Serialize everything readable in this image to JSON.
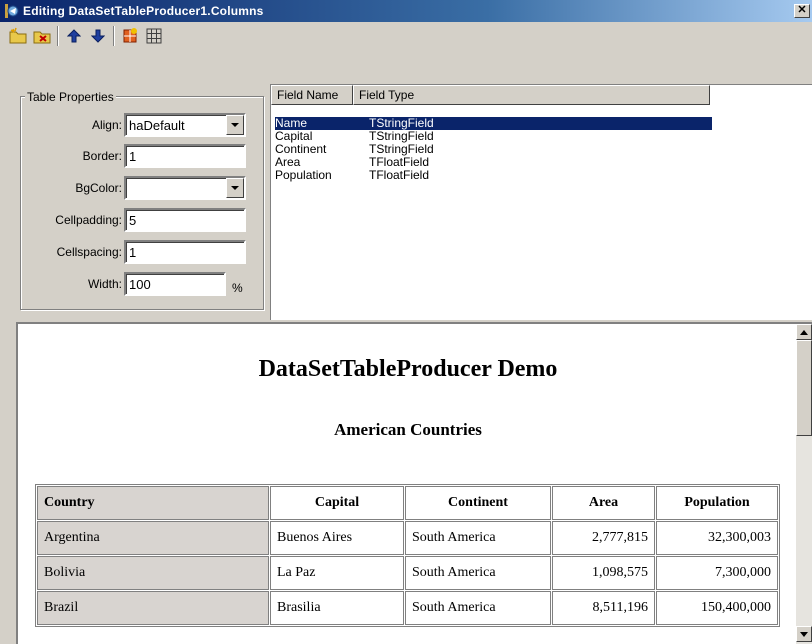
{
  "window": {
    "title": "Editing DataSetTableProducer1.Columns",
    "close_label": "✕"
  },
  "toolbar": {
    "buttons": [
      {
        "icon": "add-all-fields-icon"
      },
      {
        "icon": "delete-field-icon"
      },
      {
        "icon": "move-up-icon"
      },
      {
        "icon": "move-down-icon"
      },
      {
        "icon": "restore-defaults-icon"
      },
      {
        "icon": "grid-icon"
      }
    ]
  },
  "table_properties": {
    "caption": "Table Properties",
    "align_label": "Align:",
    "align_value": "haDefault",
    "border_label": "Border:",
    "border_value": "1",
    "bgcolor_label": "BgColor:",
    "bgcolor_value": "",
    "cellpadding_label": "Cellpadding:",
    "cellpadding_value": "5",
    "cellspacing_label": "Cellspacing:",
    "cellspacing_value": "1",
    "width_label": "Width:",
    "width_value": "100",
    "width_unit": "%"
  },
  "fields_list": {
    "columns": [
      "Field Name",
      "Field Type"
    ],
    "rows": [
      {
        "name": "Name",
        "type": "TStringField",
        "selected": true
      },
      {
        "name": "Capital",
        "type": "TStringField"
      },
      {
        "name": "Continent",
        "type": "TStringField"
      },
      {
        "name": "Area",
        "type": "TFloatField"
      },
      {
        "name": "Population",
        "type": "TFloatField"
      }
    ]
  },
  "preview": {
    "title": "DataSetTableProducer Demo",
    "subtitle": "American Countries",
    "headers": [
      "Country",
      "Capital",
      "Continent",
      "Area",
      "Population"
    ],
    "rows": [
      [
        "Argentina",
        "Buenos Aires",
        "South America",
        "2,777,815",
        "32,300,003"
      ],
      [
        "Bolivia",
        "La Paz",
        "South America",
        "1,098,575",
        "7,300,000"
      ],
      [
        "Brazil",
        "Brasilia",
        "South America",
        "8,511,196",
        "150,400,000"
      ]
    ]
  }
}
